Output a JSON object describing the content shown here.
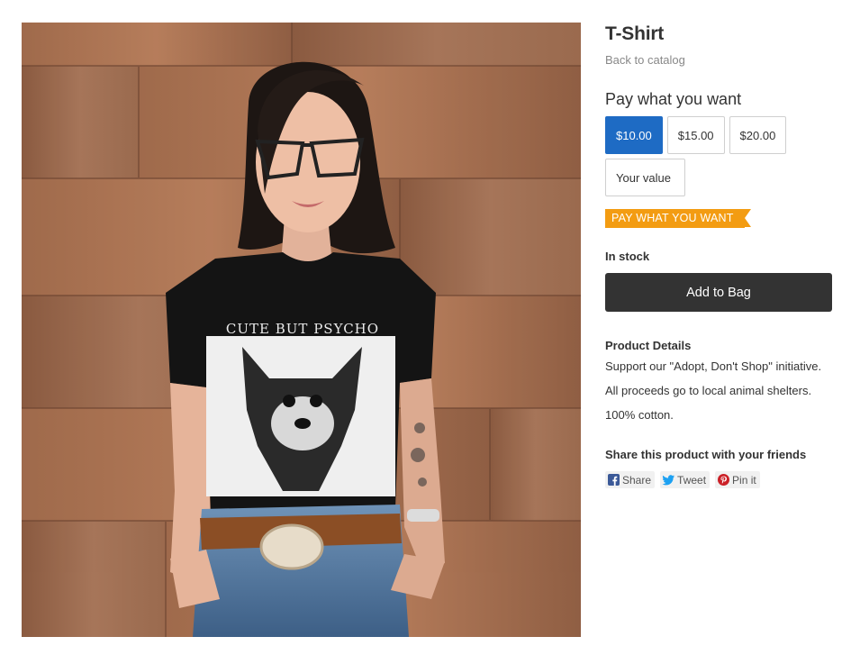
{
  "product": {
    "title": "T-Shirt",
    "back_link": "Back to catalog",
    "image": {
      "shirt_print_text": "CUTE BUT PSYCHO"
    }
  },
  "pricing": {
    "heading": "Pay what you want",
    "options": [
      {
        "label": "$10.00",
        "selected": true
      },
      {
        "label": "$15.00",
        "selected": false
      },
      {
        "label": "$20.00",
        "selected": false
      },
      {
        "label": "Your value",
        "selected": false
      }
    ],
    "ribbon_label": "PAY WHAT YOU WANT",
    "accent_color": "#1e6bc4",
    "ribbon_color": "#f39c12"
  },
  "stock_status": "In stock",
  "add_to_bag_label": "Add to Bag",
  "details": {
    "heading": "Product Details",
    "lines": [
      "Support our \"Adopt, Don't Shop\" initiative.",
      "All proceeds go to local animal shelters.",
      "100% cotton."
    ]
  },
  "share": {
    "heading": "Share this product with your friends",
    "buttons": [
      {
        "label": "Share",
        "icon": "facebook-icon",
        "color": "#3b5998"
      },
      {
        "label": "Tweet",
        "icon": "twitter-icon",
        "color": "#1da1f2"
      },
      {
        "label": "Pin it",
        "icon": "pinterest-icon",
        "color": "#cb2027"
      }
    ]
  }
}
